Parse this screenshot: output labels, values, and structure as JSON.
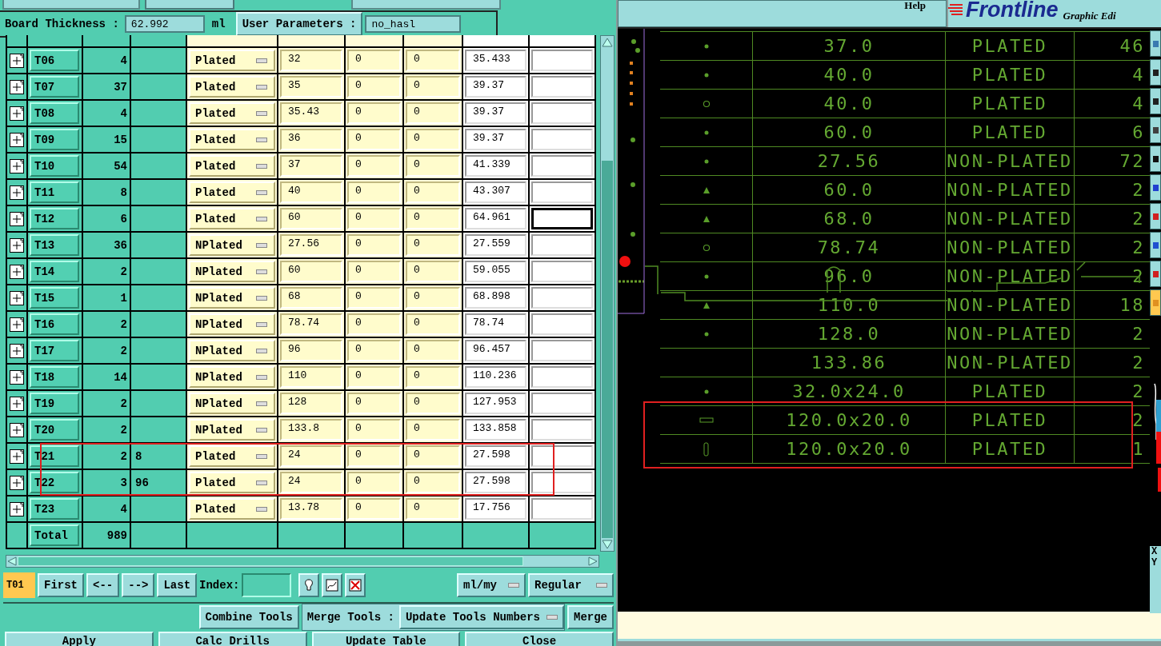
{
  "board": {
    "thickness_label": "Board Thickness :",
    "thickness_value": "62.992",
    "thickness_unit": "ml",
    "user_params_button": "User Parameters :",
    "user_params_value": "no_hasl"
  },
  "tools": [
    {
      "tool": "T06",
      "count": "4",
      "type": "Plated",
      "values": [
        "32",
        "0",
        "0",
        "35.433"
      ],
      "focused": false,
      "highlighted": false
    },
    {
      "tool": "T07",
      "count": "37",
      "type": "Plated",
      "values": [
        "35",
        "0",
        "0",
        "39.37"
      ],
      "focused": false,
      "highlighted": false
    },
    {
      "tool": "T08",
      "count": "4",
      "type": "Plated",
      "values": [
        "35.43",
        "0",
        "0",
        "39.37"
      ],
      "focused": false,
      "highlighted": false
    },
    {
      "tool": "T09",
      "count": "15",
      "type": "Plated",
      "values": [
        "36",
        "0",
        "0",
        "39.37"
      ],
      "focused": false,
      "highlighted": false
    },
    {
      "tool": "T10",
      "count": "54",
      "type": "Plated",
      "values": [
        "37",
        "0",
        "0",
        "41.339"
      ],
      "focused": false,
      "highlighted": false
    },
    {
      "tool": "T11",
      "count": "8",
      "type": "Plated",
      "values": [
        "40",
        "0",
        "0",
        "43.307"
      ],
      "focused": false,
      "highlighted": false
    },
    {
      "tool": "T12",
      "count": "6",
      "type": "Plated",
      "values": [
        "60",
        "0",
        "0",
        "64.961"
      ],
      "focused": true,
      "highlighted": false
    },
    {
      "tool": "T13",
      "count": "36",
      "type": "NPlated",
      "values": [
        "27.56",
        "0",
        "0",
        "27.559"
      ],
      "focused": false,
      "highlighted": false
    },
    {
      "tool": "T14",
      "count": "2",
      "type": "NPlated",
      "values": [
        "60",
        "0",
        "0",
        "59.055"
      ],
      "focused": false,
      "highlighted": false
    },
    {
      "tool": "T15",
      "count": "1",
      "type": "NPlated",
      "values": [
        "68",
        "0",
        "0",
        "68.898"
      ],
      "focused": false,
      "highlighted": false
    },
    {
      "tool": "T16",
      "count": "2",
      "type": "NPlated",
      "values": [
        "78.74",
        "0",
        "0",
        "78.74"
      ],
      "focused": false,
      "highlighted": false
    },
    {
      "tool": "T17",
      "count": "2",
      "type": "NPlated",
      "values": [
        "96",
        "0",
        "0",
        "96.457"
      ],
      "focused": false,
      "highlighted": false
    },
    {
      "tool": "T18",
      "count": "14",
      "type": "NPlated",
      "values": [
        "110",
        "0",
        "0",
        "110.236"
      ],
      "focused": false,
      "highlighted": false
    },
    {
      "tool": "T19",
      "count": "2",
      "type": "NPlated",
      "values": [
        "128",
        "0",
        "0",
        "127.953"
      ],
      "focused": false,
      "highlighted": false
    },
    {
      "tool": "T20",
      "count": "2",
      "type": "NPlated",
      "values": [
        "133.8",
        "0",
        "0",
        "133.858"
      ],
      "focused": false,
      "highlighted": false
    },
    {
      "tool": "T21",
      "count": "2",
      "column_3": "8",
      "type": "Plated",
      "values": [
        "24",
        "0",
        "0",
        "27.598"
      ],
      "focused": false,
      "highlighted": true
    },
    {
      "tool": "T22",
      "count": "3",
      "column_3": "96",
      "type": "Plated",
      "values": [
        "24",
        "0",
        "0",
        "27.598"
      ],
      "focused": false,
      "highlighted": true
    },
    {
      "tool": "T23",
      "count": "4",
      "type": "Plated",
      "values": [
        "13.78",
        "0",
        "0",
        "17.756"
      ],
      "focused": false,
      "highlighted": false
    }
  ],
  "total": {
    "label": "Total",
    "count": "989"
  },
  "nav": {
    "current": "T01",
    "buttons": [
      "First",
      "<--",
      "-->",
      "Last"
    ],
    "index_label": "Index:",
    "units": "ml/my",
    "mode": "Regular"
  },
  "merge": {
    "combine_button": "Combine Tools",
    "merge_label": "Merge Tools :",
    "merge_option": "Update Tools Numbers",
    "merge_button": "Merge"
  },
  "actions": [
    "Apply",
    "Calc Drills",
    "Update Table",
    "Close"
  ],
  "graphic": {
    "help": "Help",
    "logo": "Frontline",
    "subtitle": "Graphic Edi",
    "coords": [
      "X",
      "Y"
    ]
  },
  "drills": [
    {
      "kind": "round",
      "size": "37.0",
      "plating": "PLATED",
      "count": "46",
      "highlighted": false
    },
    {
      "kind": "round",
      "size": "40.0",
      "plating": "PLATED",
      "count": "4",
      "highlighted": false
    },
    {
      "kind": "ring",
      "size": "40.0",
      "plating": "PLATED",
      "count": "4",
      "highlighted": false
    },
    {
      "kind": "round",
      "size": "60.0",
      "plating": "PLATED",
      "count": "6",
      "highlighted": false
    },
    {
      "kind": "round",
      "size": "27.56",
      "plating": "NON-PLATED",
      "count": "72",
      "highlighted": false
    },
    {
      "kind": "triangle",
      "size": "60.0",
      "plating": "NON-PLATED",
      "count": "2",
      "highlighted": false
    },
    {
      "kind": "triangle",
      "size": "68.0",
      "plating": "NON-PLATED",
      "count": "2",
      "highlighted": false
    },
    {
      "kind": "ring",
      "size": "78.74",
      "plating": "NON-PLATED",
      "count": "2",
      "highlighted": false
    },
    {
      "kind": "round",
      "size": "96.0",
      "plating": "NON-PLATED",
      "count": "2",
      "highlighted": false
    },
    {
      "kind": "triangle",
      "size": "110.0",
      "plating": "NON-PLATED",
      "count": "18",
      "highlighted": false
    },
    {
      "kind": "round",
      "size": "128.0",
      "plating": "NON-PLATED",
      "count": "2",
      "highlighted": false
    },
    {
      "size": "133.86",
      "plating": "NON-PLATED",
      "count": "2",
      "highlighted": false
    },
    {
      "kind": "round",
      "size": "32.0x24.0",
      "plating": "PLATED",
      "count": "2",
      "highlighted": false
    },
    {
      "kind": "slot_horizontal",
      "size": "120.0x20.0",
      "plating": "PLATED",
      "count": "2",
      "highlighted": true
    },
    {
      "kind": "slot_vertical",
      "size": "120.0x20.0",
      "plating": "PLATED",
      "count": "1",
      "highlighted": true
    }
  ]
}
